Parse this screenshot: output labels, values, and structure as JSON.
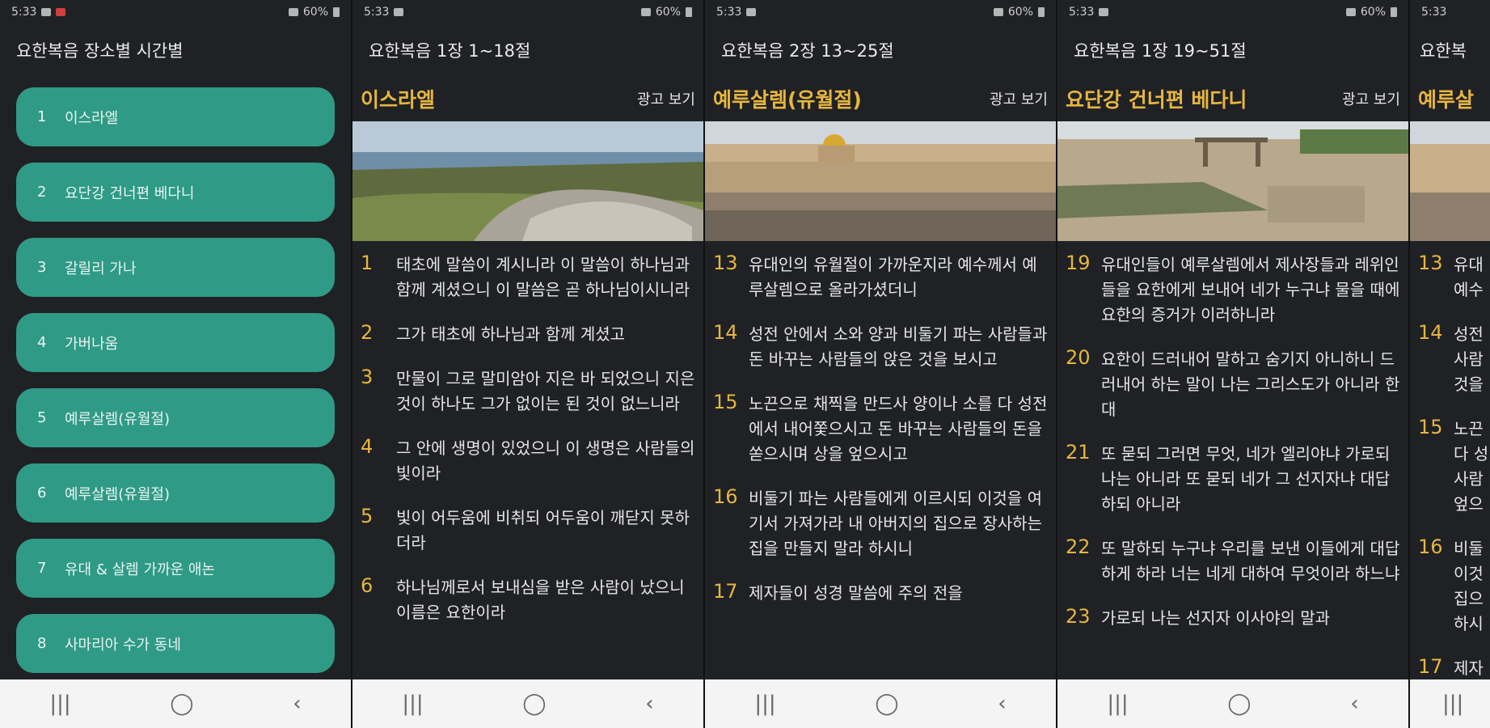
{
  "status": {
    "time": "5:33",
    "battery": "60%"
  },
  "p1": {
    "title": "요한복음 장소별 시간별",
    "items": [
      {
        "num": "1",
        "label": "이스라엘"
      },
      {
        "num": "2",
        "label": "요단강 건너편 베다니"
      },
      {
        "num": "3",
        "label": "갈릴리 가나"
      },
      {
        "num": "4",
        "label": "가버나움"
      },
      {
        "num": "5",
        "label": "예루살렘(유월절)"
      },
      {
        "num": "6",
        "label": "예루살렘(유월절)"
      },
      {
        "num": "7",
        "label": "유대 & 살렘 가까운 애논"
      },
      {
        "num": "8",
        "label": "사마리아 수가 동네"
      }
    ]
  },
  "p2": {
    "title": "요한복음 1장 1~18절",
    "place": "이스라엘",
    "ad": "광고 보기",
    "verses": [
      {
        "n": "1",
        "t": "태초에 말씀이 계시니라 이 말씀이 하나님과 함께 계셨으니 이 말씀은 곧 하나님이시니라"
      },
      {
        "n": "2",
        "t": "그가 태초에 하나님과 함께 계셨고"
      },
      {
        "n": "3",
        "t": "만물이 그로 말미암아 지은 바 되었으니 지은 것이 하나도 그가 없이는 된 것이 없느니라"
      },
      {
        "n": "4",
        "t": "그 안에 생명이 있었으니 이 생명은 사람들의 빛이라"
      },
      {
        "n": "5",
        "t": "빛이 어두움에 비취되 어두움이 깨닫지 못하더라"
      },
      {
        "n": "6",
        "t": "하나님께로서 보내심을 받은 사람이 났으니 이름은 요한이라"
      }
    ]
  },
  "p3": {
    "title": "요한복음 2장 13~25절",
    "place": "예루살렘(유월절)",
    "ad": "광고 보기",
    "verses": [
      {
        "n": "13",
        "t": "유대인의 유월절이 가까운지라 예수께서 예루살렘으로 올라가셨더니"
      },
      {
        "n": "14",
        "t": "성전 안에서 소와 양과 비둘기 파는 사람들과 돈 바꾸는 사람들의 앉은 것을 보시고"
      },
      {
        "n": "15",
        "t": "노끈으로 채찍을 만드사 양이나 소를 다 성전에서 내어쫓으시고 돈 바꾸는 사람들의 돈을 쏟으시며 상을 엎으시고"
      },
      {
        "n": "16",
        "t": "비둘기 파는 사람들에게 이르시되 이것을 여기서 가져가라 내 아버지의 집으로 장사하는 집을 만들지 말라 하시니"
      },
      {
        "n": "17",
        "t": "제자들이 성경 말씀에 주의 전을"
      }
    ]
  },
  "p4": {
    "title": "요한복음 1장 19~51절",
    "place": "요단강 건너편 베다니",
    "ad": "광고 보기",
    "verses": [
      {
        "n": "19",
        "t": "유대인들이 예루살렘에서 제사장들과 레위인들을 요한에게 보내어 네가 누구냐 물을 때에 요한의 증거가 이러하니라"
      },
      {
        "n": "20",
        "t": "요한이 드러내어 말하고 숨기지 아니하니 드러내어 하는 말이 나는 그리스도가 아니라 한대"
      },
      {
        "n": "21",
        "t": "또 묻되 그러면 무엇, 네가 엘리야냐 가로되 나는 아니라 또 묻되 네가 그 선지자냐 대답하되 아니라"
      },
      {
        "n": "22",
        "t": "또 말하되 누구냐 우리를 보낸 이들에게 대답하게 하라 너는 네게 대하여 무엇이라 하느냐"
      },
      {
        "n": "23",
        "t": "가로되 나는 선지자 이사야의 말과"
      }
    ]
  },
  "p5": {
    "title": "요한복",
    "place": "예루살",
    "verses": [
      {
        "n": "13",
        "t": "유대"
      },
      {
        "n": "",
        "t": "예수"
      },
      {
        "n": "14",
        "t": "성전"
      },
      {
        "n": "",
        "t": "사람"
      },
      {
        "n": "",
        "t": "것을"
      },
      {
        "n": "15",
        "t": "노끈"
      },
      {
        "n": "",
        "t": "다 성"
      },
      {
        "n": "",
        "t": "사람"
      },
      {
        "n": "",
        "t": "엎으"
      },
      {
        "n": "16",
        "t": "비둘"
      },
      {
        "n": "",
        "t": "이것"
      },
      {
        "n": "",
        "t": "집으"
      },
      {
        "n": "",
        "t": "하시"
      },
      {
        "n": "17",
        "t": "제자"
      }
    ]
  },
  "nav": {
    "recents": "|||",
    "home": "◯",
    "back": "‹"
  }
}
